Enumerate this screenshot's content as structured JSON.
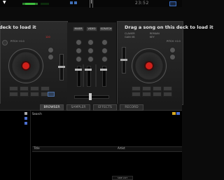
{
  "topbar": {
    "time": "23:52",
    "drop_mark": "▼"
  },
  "deck_left": {
    "load_text": "deck to load it",
    "pitch_label": "PITCH +0.0",
    "bpm_label": "120"
  },
  "deck_right": {
    "load_text": "Drag a song on this deck to load it",
    "clavier_label": "CLAVIER",
    "gain_label": "GAIN 0B",
    "remain_label": "REMAIN",
    "key_label": "KEY",
    "pitch_label": "PITCH +0.0"
  },
  "mixer": {
    "buttons": [
      "MIXER",
      "VIDEO",
      "SCRATCH"
    ],
    "xfader_label": "XFADER"
  },
  "tabs": [
    "BROWSER",
    "SAMPLER",
    "EFFECTS",
    "RECORD"
  ],
  "browser": {
    "search_label": "Search",
    "columns": [
      "Title",
      "Artist"
    ],
    "sidelist_label": "SIDE LIST"
  },
  "colors": {
    "accent_red": "#d0201a",
    "meter_green": "#3fbf3f",
    "link_blue": "#3a6ec2"
  }
}
